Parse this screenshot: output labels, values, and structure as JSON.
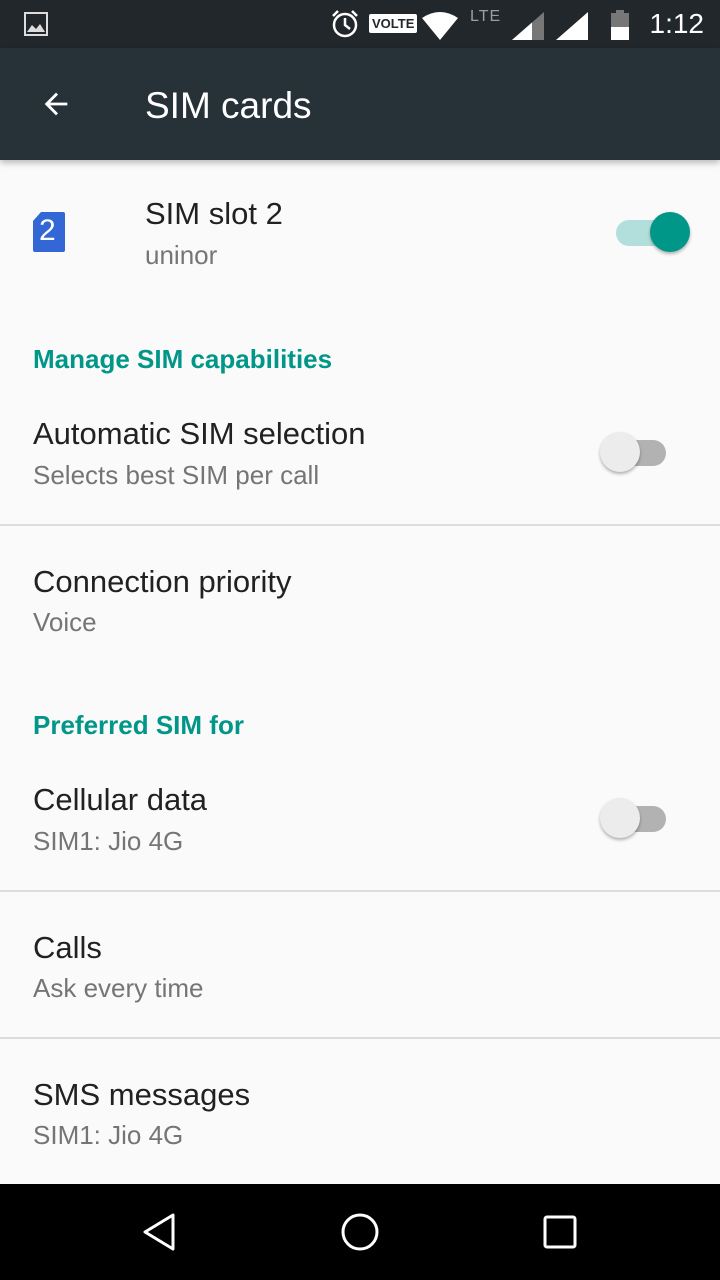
{
  "status_bar": {
    "time": "1:12",
    "volte_label": "VOLTE",
    "lte_label": "LTE",
    "battery_level": "41",
    "icons": [
      "image-icon",
      "alarm-icon",
      "volte-icon",
      "wifi-icon",
      "lte-icon",
      "signal-sim1-icon",
      "signal-sim2-icon",
      "battery-icon"
    ]
  },
  "toolbar": {
    "title": "SIM cards",
    "back_icon": "arrow-back-icon"
  },
  "sim_slot": {
    "badge_number": "2",
    "title": "SIM slot 2",
    "carrier": "uninor",
    "enabled": true,
    "badge_color": "#3367d6"
  },
  "sections": {
    "manage": "Manage SIM capabilities",
    "preferred": "Preferred SIM for"
  },
  "items": {
    "auto_selection": {
      "title": "Automatic SIM selection",
      "summary": "Selects best SIM per call",
      "enabled": false
    },
    "connection_priority": {
      "title": "Connection priority",
      "summary": "Voice"
    },
    "cellular_data": {
      "title": "Cellular data",
      "summary": "SIM1: Jio 4G",
      "enabled": false
    },
    "calls": {
      "title": "Calls",
      "summary": "Ask every time"
    },
    "sms": {
      "title": "SMS messages",
      "summary": "SIM1: Jio 4G"
    }
  },
  "colors": {
    "accent": "#009688",
    "toolbar": "#263238",
    "status_bar": "#21272b"
  },
  "nav_bar": {
    "icons": [
      "nav-back-icon",
      "nav-home-icon",
      "nav-recents-icon"
    ]
  }
}
